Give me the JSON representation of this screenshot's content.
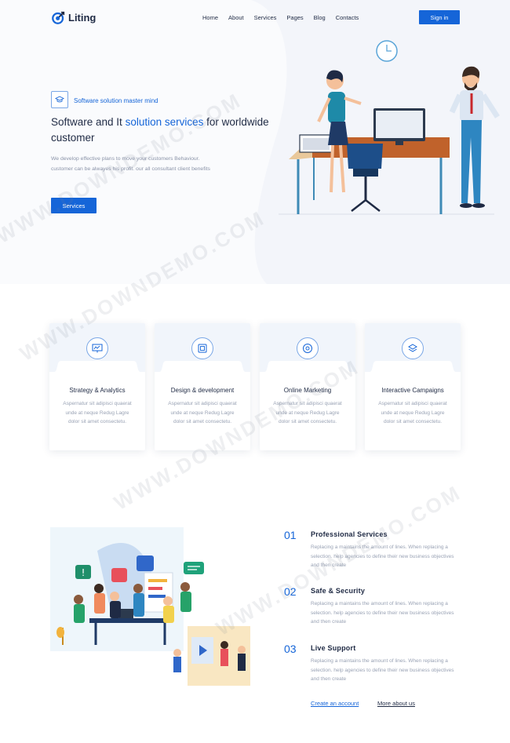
{
  "brand": {
    "name": "Liting"
  },
  "nav": {
    "items": [
      "Home",
      "About",
      "Services",
      "Pages",
      "Blog",
      "Contacts"
    ],
    "signin_label": "Sign in"
  },
  "hero": {
    "badge_text": "Software solution master mind",
    "title_part1": "Software and It ",
    "title_highlight": "solution services",
    "title_part2": " for worldwide customer",
    "description": "We develop effective plans to move your customers Behaviour. customer can be alwayes his profit. our all consultant client benefits",
    "button_label": "Services"
  },
  "services": [
    {
      "title": "Strategy & Analytics",
      "desc": "Aspernatur sit adipisci quaerat unde at neque Redug Lagre dolor sit amet consectetu.",
      "icon": "chart-board-icon"
    },
    {
      "title": "Design & development",
      "desc": "Aspernatur sit adipisci quaerat unde at neque Redug Lagre dolor sit amet consectetu.",
      "icon": "design-screen-icon"
    },
    {
      "title": "Online Marketing",
      "desc": "Aspernatur sit adipisci quaerat unde at neque Redug Lagre dolor sit amet consectetu.",
      "icon": "marketing-target-icon"
    },
    {
      "title": "Interactive Campaigns",
      "desc": "Aspernatur sit adipisci quaerat unde at neque Redug Lagre dolor sit amet consectetu.",
      "icon": "layers-icon"
    }
  ],
  "features": [
    {
      "num": "01",
      "title": "Professional Services",
      "desc": "Replacing a maintains the amount of lines. When replacing a selection. help agencies to define their new business objectives and then create"
    },
    {
      "num": "02",
      "title": "Safe & Security",
      "desc": "Replacing a maintains the amount of lines. When replacing a selection. help agencies to define their new business objectives and then create"
    },
    {
      "num": "03",
      "title": "Live Support",
      "desc": "Replacing a maintains the amount of lines. When replacing a selection. help agencies to define their new business objectives and then create"
    }
  ],
  "links": {
    "create_account": "Create an account",
    "more_about": "More about us"
  },
  "watermark": "WWW.DOWNDEMO.COM",
  "colors": {
    "primary": "#1565d8",
    "heading": "#1f2a44",
    "muted": "#9aa3b5"
  }
}
